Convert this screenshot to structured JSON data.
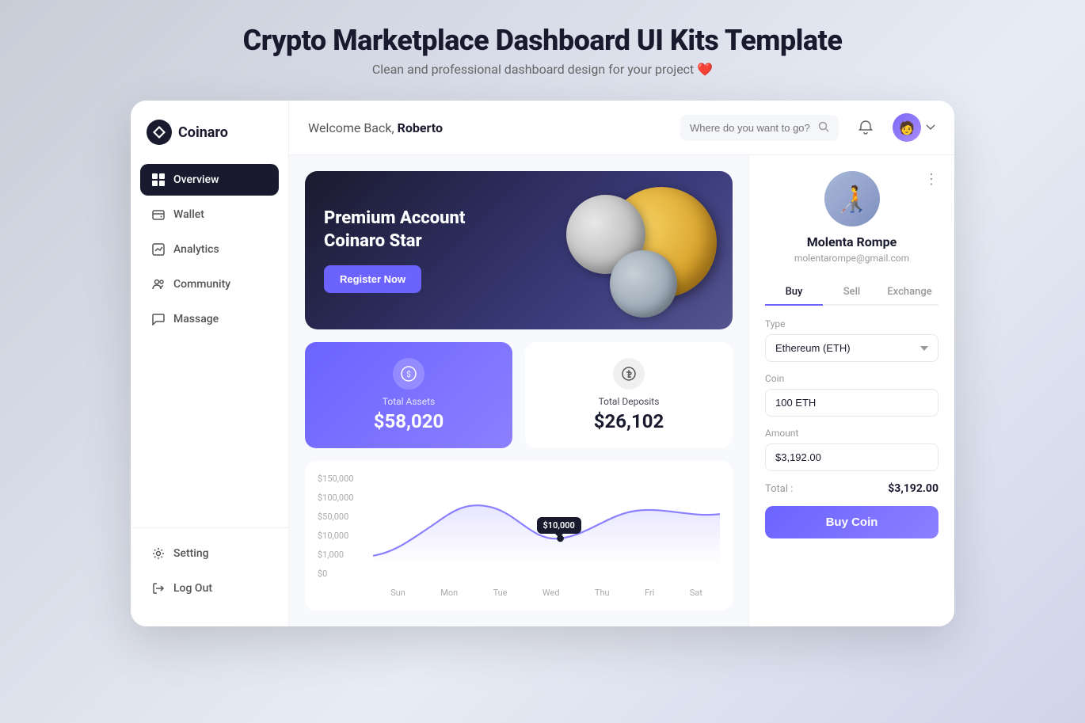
{
  "page": {
    "title": "Crypto Marketplace Dashboard UI Kits Template",
    "subtitle": "Clean and professional dashboard design for your project",
    "heart": "❤️"
  },
  "sidebar": {
    "logo_text": "Coinaro",
    "nav_items": [
      {
        "id": "overview",
        "label": "Overview",
        "active": true
      },
      {
        "id": "wallet",
        "label": "Wallet",
        "active": false
      },
      {
        "id": "analytics",
        "label": "Analytics",
        "active": false
      },
      {
        "id": "community",
        "label": "Community",
        "active": false
      },
      {
        "id": "massage",
        "label": "Massage",
        "active": false
      }
    ],
    "bottom_items": [
      {
        "id": "setting",
        "label": "Setting"
      },
      {
        "id": "logout",
        "label": "Log Out"
      }
    ]
  },
  "header": {
    "welcome_prefix": "Welcome Back, ",
    "username": "Roberto",
    "search_placeholder": "Where do you want to go?"
  },
  "banner": {
    "title_line1": "Premium Account",
    "title_line2": "Coinaro Star",
    "button_label": "Register Now"
  },
  "stats": {
    "total_assets_label": "Total Assets",
    "total_assets_value": "$58,020",
    "total_deposits_label": "Total Deposits",
    "total_deposits_value": "$26,102"
  },
  "chart": {
    "y_labels": [
      "$150,000",
      "$100,000",
      "$50,000",
      "$10,000",
      "$1,000",
      "$0"
    ],
    "x_labels": [
      "Sun",
      "Mon",
      "Tue",
      "Wed",
      "Thu",
      "Fri",
      "Sat"
    ],
    "tooltip_value": "$10,000"
  },
  "profile": {
    "name": "Molenta Rompe",
    "email": "molentarompe@gmail.com"
  },
  "trade": {
    "tabs": [
      "Buy",
      "Sell",
      "Exchange"
    ],
    "active_tab": "Buy",
    "type_label": "Type",
    "type_value": "Ethereum (ETH)",
    "coin_label": "Coin",
    "coin_value": "100 ETH",
    "amount_label": "Amount",
    "amount_value": "$3,192.00",
    "total_label": "Total :",
    "total_value": "$3,192.00",
    "buy_button": "Buy Coin"
  }
}
